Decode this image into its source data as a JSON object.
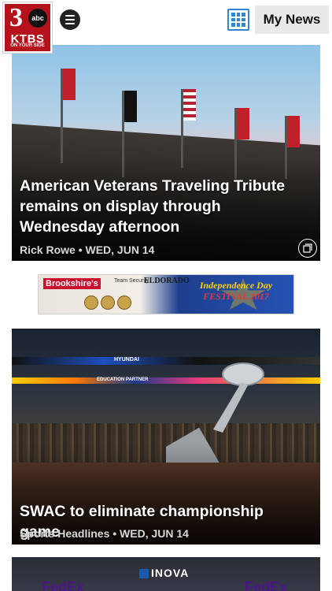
{
  "header": {
    "logo": {
      "number": "3",
      "network": "abc",
      "callsign": "KTBS",
      "tagline": "ON YOUR SIDE"
    },
    "menu_icon": "hamburger-menu-icon",
    "grid_icon": "grid-view-icon",
    "my_news_label": "My News",
    "accent_color": "#2e86d6"
  },
  "stories": [
    {
      "headline": "American Veterans Traveling Tribute remains on display through Wednesday afternoon",
      "byline": "Rick Rowe • WED, JUN 14",
      "badge_icon": "photo-gallery-icon"
    },
    {
      "headline": "SWAC to eliminate championship game",
      "byline": "Sports Headlines • WED, JUN 14"
    },
    {
      "partial_text": {
        "sponsor_left": "FedEx",
        "sponsor_center": "INOVA",
        "sponsor_right": "FedEx"
      }
    }
  ],
  "ad": {
    "brand": "Brookshire's",
    "partner": "Team Security",
    "partner2": "ELDORADO",
    "event_line1": "Independence Day",
    "event_line2": "FESTIVAL 2017"
  },
  "scene_text": {
    "scoreboard": "HYUNDAI",
    "banner": "EDUCATION PARTNER"
  }
}
